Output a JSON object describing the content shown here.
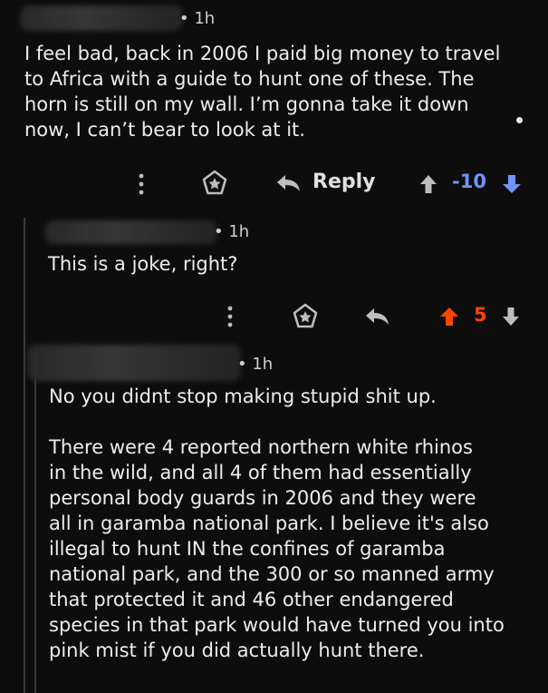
{
  "colors": {
    "background": "#0d0d0d",
    "text": "#ededed",
    "upvote": "#ff4500",
    "downvote": "#7193ff",
    "icon": "#bdbdbd"
  },
  "comments": [
    {
      "time": "1h",
      "body_lines": [
        "I feel bad, back in 2006 I paid big money to travel",
        "to Africa with a guide to hunt one of these. The",
        "horn is still on my wall. I’m gonna take it down",
        "now, I can’t bear to look at it."
      ],
      "actions": {
        "reply_label": "Reply",
        "score": "-10",
        "icons": [
          "more-icon",
          "award-icon",
          "reply-icon",
          "upvote-icon",
          "downvote-icon"
        ]
      }
    },
    {
      "time": "1h",
      "body_lines": [
        "This is a joke, right?"
      ],
      "actions": {
        "score": "5",
        "icons": [
          "more-icon",
          "award-icon",
          "reply-icon",
          "upvote-icon",
          "downvote-icon"
        ]
      }
    },
    {
      "time": "1h",
      "body_lines": [
        "No you didnt stop making stupid shit up.",
        "",
        "There were 4 reported northern white rhinos",
        "in the wild, and all 4 of them had essentially",
        "personal body guards in 2006 and they were",
        "all in garamba national park. I believe it's also",
        "illegal to hunt IN the confines of garamba",
        "national park, and the 300 or so manned army",
        "that protected it and 46 other endangered",
        "species in that park would have turned you into",
        "pink mist if you did actually hunt there."
      ]
    }
  ]
}
